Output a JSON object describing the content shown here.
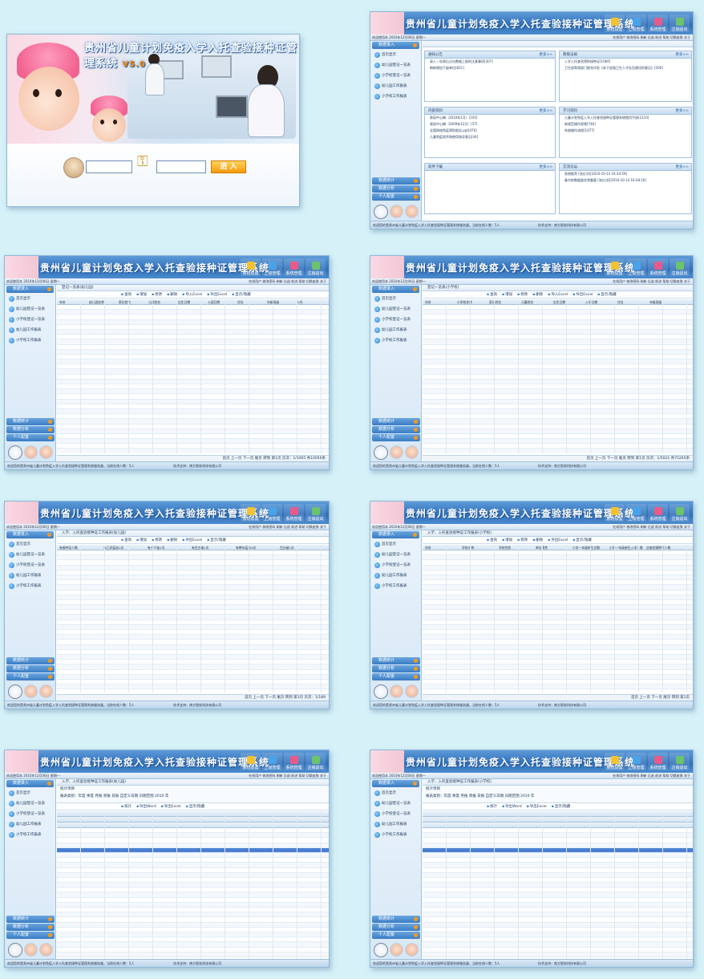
{
  "login": {
    "title": "贵州省儿童计划免疫入学入托查验接种证管理系统",
    "version": "V5.0",
    "login_button": "进 入"
  },
  "app": {
    "title": "贵州省儿童计划免疫入学入托查验接种证管理系统",
    "top_buttons": [
      "系统设置",
      "上级管理",
      "系统管理",
      "注销退出"
    ],
    "status_left": "欢迎使用本 2010年12月06日 星期一",
    "status_right": "在线用户  修改密码  刷新  后退  前进  帮助  切换皮肤  关于",
    "footer_left": "欢迎您的是贵州省儿童计划免疫入学入托查验接种证管理系统服务器，当前在线人数：5人",
    "footer_right": "技术支持：南方智软科技有限公司",
    "sidebar_header": "数据录入",
    "sidebar_items": [
      "首页显示",
      "幼儿园登记一览表",
      "小学校登记一览表",
      "幼儿园工作报表",
      "小学校工作报表"
    ],
    "sidebar_bottom": [
      "数据统计",
      "数据分析",
      "个人配置"
    ]
  },
  "home": {
    "panels": [
      {
        "title": "通知公告",
        "more": "更多>>",
        "items": [
          "录入一览表后点击数据上报的注意事项[307]",
          "刷新增加下级单位[821]"
        ]
      },
      {
        "title": "政策法规",
        "more": "更多>>",
        "items": [
          "入学入托查验预防接种证[1060]",
          "卫生部等两部门联合印发《关于加强卫生人才队伍建设的意见》[200]"
        ]
      },
      {
        "title": "内部资料",
        "more": "更多>>",
        "items": [
          "表现中心稿（2010年1月）[105]",
          "表现中心稿（2009年12月）[57]",
          "全国网络免疫预防报告.ppt[476]",
          "儿童免疫程序和使用指导意见[44]"
        ]
      },
      {
        "title": "学习资料",
        "more": "更多>>",
        "items": [
          "儿童计划免疫入学入托查验接种证管理系统使用手册[2110]",
          "新规范操作视频[746]",
          "系统操作流程[1077]"
        ]
      },
      {
        "title": "软件下载",
        "more": "更多>>",
        "items": []
      },
      {
        "title": "交流论坛",
        "more": "更多>>",
        "items": [
          "系统推荐 [张红洋][2010-10-14 16:34:59]",
          "春节前数据量非常重要 [张红洋][2010-10-14 16:28:16]"
        ]
      }
    ]
  },
  "screens": {
    "kindergarten_list": {
      "crumb": "登记一览表(幼儿园)",
      "tools": [
        "查询",
        "增加",
        "修改",
        "删除",
        "导入Excel",
        "导出Excel",
        "显示/隐藏"
      ],
      "columns": [
        "年份",
        "幼儿园名称",
        "家长姓名",
        "儿童姓名",
        "出生日期",
        "入园日期",
        "住址",
        "年级班级",
        "入托"
      ],
      "pager": "首页  上一页  下一页  尾页  转到 第1页  页次：1/1005  共10050条"
    },
    "school_list": {
      "crumb": "登记一览表(小学校)",
      "tools": [
        "查询",
        "增加",
        "修改",
        "删除",
        "导入Excel",
        "导出Excel",
        "显示/隐藏"
      ],
      "columns": [
        "年份",
        "小学校名称",
        "家长姓名",
        "儿童姓名",
        "出生日期",
        "入学日期",
        "住址",
        "年级班级"
      ],
      "pager": "首页  上一页  下一页  尾页  转到 第1页  页次：1/5021  共75265条"
    },
    "kg_report": {
      "crumb": "入学、入托查验接种证工作报表(幼儿园)",
      "tools": [
        "查询",
        "增加",
        "修改",
        "删除",
        "导出Excel",
        "显示/隐藏"
      ],
      "columns": [
        "有接种证人数",
        "有乙肝疫苗1次",
        "有卡介苗1次",
        "有百白破1次",
        "有脊灰疫苗3次",
        "百白破1次"
      ],
      "pager": "首页  上一页  下一页  尾页  转到 第1页  页次：1/189"
    },
    "school_report": {
      "crumb": "入学、入托查验接种证工作报表(小学校)",
      "tools": [
        "查询",
        "增加",
        "修改",
        "删除",
        "导出Excel",
        "显示/隐藏"
      ],
      "columns": [
        "年份",
        "学校名称",
        "学校性质",
        "单位属性",
        "小学一年级新生总数",
        "小学一年级新生入学人数",
        "应查验接种证人数"
      ],
      "pager": "首页  上一页  下一页  尾页  转到 第1页"
    },
    "kg_stats": {
      "crumb": "入学、入托查验接种证工作报表(幼儿园)",
      "stat_title": "统计项目",
      "stat_options": "报表类别：年度  季度  月报  周报  日报  自定义日期  日期范围 2010 年",
      "tools": [
        "统计",
        "导出Word",
        "导出Excel",
        "显示/隐藏"
      ]
    },
    "school_stats": {
      "crumb": "入学、入托查验接种证工作报表(小学校)",
      "stat_title": "统计项目",
      "stat_options": "报表类别：年度  季度  月报  周报  日报  自定义日期  日期范围 2010 年",
      "tools": [
        "统计",
        "导出Word",
        "导出Excel",
        "显示/隐藏"
      ]
    }
  },
  "colors": {
    "page_bg": "#d6f1f8",
    "header_blue": "#2f6fb8",
    "selected_row": "#4a7fd0",
    "accent_orange": "#f39a1a"
  }
}
